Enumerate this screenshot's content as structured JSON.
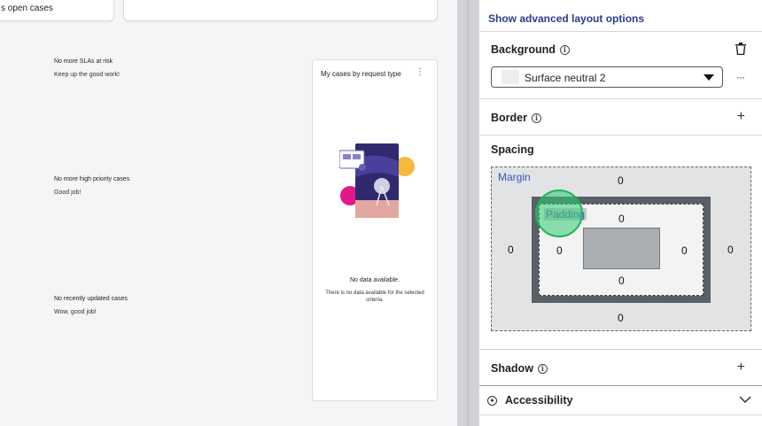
{
  "canvas": {
    "top_card_text": "s open cases",
    "empty_states": [
      {
        "title": "No more SLAs at risk",
        "subtitle": "Keep up the good work!"
      },
      {
        "title": "No more high priority cases",
        "subtitle": "Good job!"
      },
      {
        "title": "No recently updated cases",
        "subtitle": "Wow, good job!"
      }
    ],
    "request_card": {
      "title": "My cases by request type",
      "menu_icon": "kebab-icon",
      "no_data_title": "No data available.",
      "no_data_text": "There is no data available for the selected criteria."
    }
  },
  "panel": {
    "advanced_link": "Show advanced layout options",
    "background": {
      "title": "Background",
      "info_icon": "info-icon",
      "delete_icon": "trash-icon",
      "selected_value": "Surface neutral 2",
      "more_label": "···"
    },
    "border": {
      "title": "Border",
      "action_icon": "plus-icon",
      "action_label": "+"
    },
    "spacing": {
      "title": "Spacing",
      "margin_label": "Margin",
      "padding_label": "Padding",
      "margin": {
        "top": "0",
        "right": "0",
        "bottom": "0",
        "left": "0"
      },
      "padding": {
        "top": "0",
        "right": "0",
        "bottom": "0",
        "left": "0"
      }
    },
    "shadow": {
      "title": "Shadow",
      "action_label": "+"
    },
    "accessibility": {
      "title": "Accessibility",
      "icon": "accessibility-icon",
      "icon_glyph": "✦",
      "expand_icon": "chevron-down-icon"
    }
  },
  "colors": {
    "accent_link": "#2a3d8f",
    "label_blue": "#3c55c6",
    "click_highlight": "#2ecc71"
  }
}
